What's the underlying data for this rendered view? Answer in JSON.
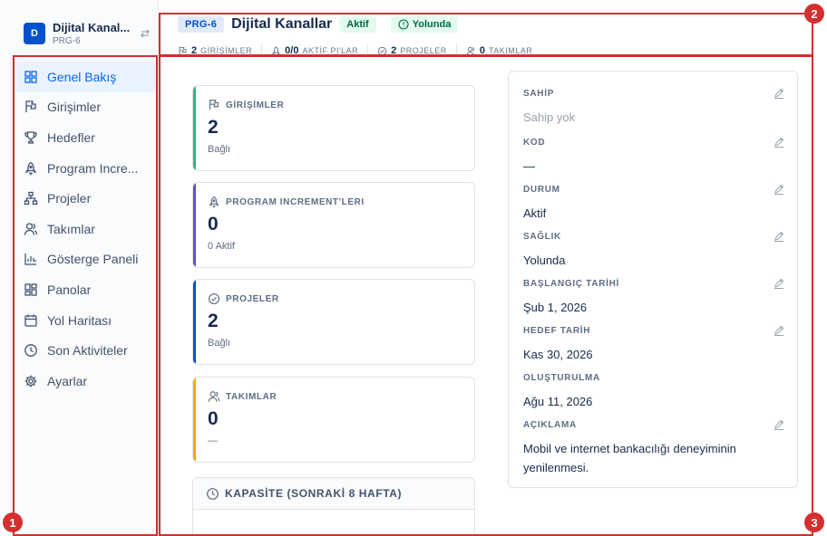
{
  "project": {
    "avatar_letter": "D",
    "name": "Dijital Kanallar",
    "name_truncated": "Dijital Kanal...",
    "key": "PRG-6"
  },
  "sidebar": {
    "items": [
      {
        "label": "Genel Bakış",
        "icon": "grid-icon",
        "active": true
      },
      {
        "label": "Girişimler",
        "icon": "flag-icon"
      },
      {
        "label": "Hedefler",
        "icon": "trophy-icon"
      },
      {
        "label": "Program Incre...",
        "icon": "rocket-icon"
      },
      {
        "label": "Projeler",
        "icon": "hierarchy-icon"
      },
      {
        "label": "Takımlar",
        "icon": "people-icon"
      },
      {
        "label": "Gösterge Paneli",
        "icon": "bar-chart-icon"
      },
      {
        "label": "Panolar",
        "icon": "board-icon"
      },
      {
        "label": "Yol Haritası",
        "icon": "calendar-icon"
      },
      {
        "label": "Son Aktiviteler",
        "icon": "clock-icon"
      },
      {
        "label": "Ayarlar",
        "icon": "gear-icon"
      }
    ]
  },
  "header": {
    "key": "PRG-6",
    "title": "Dijital Kanallar",
    "status": "Aktif",
    "health": "Yolunda",
    "stats": [
      {
        "value": "2",
        "label": "GİRİŞİMLER",
        "icon": "flag-icon"
      },
      {
        "value": "0/0",
        "label": "AKTİF PI'LAR",
        "icon": "rocket-icon"
      },
      {
        "value": "2",
        "label": "PROJELER",
        "icon": "check-circle-icon"
      },
      {
        "value": "0",
        "label": "TAKIMLAR",
        "icon": "people-icon"
      }
    ]
  },
  "cards": [
    {
      "title": "GİRİŞİMLER",
      "value": "2",
      "sub": "Bağlı",
      "icon": "flag-icon",
      "color": "#36b37e"
    },
    {
      "title": "PROGRAM INCREMENT'LERI",
      "value": "0",
      "sub": "0 Aktif",
      "icon": "rocket-icon",
      "color": "#6554c0"
    },
    {
      "title": "PROJELER",
      "value": "2",
      "sub": "Bağlı",
      "icon": "check-circle-icon",
      "color": "#0052cc"
    },
    {
      "title": "TAKIMLAR",
      "value": "0",
      "sub": "—",
      "icon": "people-icon",
      "color": "#ffab00"
    }
  ],
  "capacity": {
    "title": "KAPASİTE (SONRAKİ 8 HAFTA)"
  },
  "details": {
    "fields": [
      {
        "label": "SAHİP",
        "value": "Sahip yok",
        "muted": true,
        "editable": true
      },
      {
        "label": "KOD",
        "value": "—",
        "editable": true
      },
      {
        "label": "DURUM",
        "value": "Aktif",
        "editable": true
      },
      {
        "label": "SAĞLIK",
        "value": "Yolunda",
        "editable": true
      },
      {
        "label": "BAŞLANGIÇ TARİHİ",
        "value": "Şub 1, 2026",
        "editable": true
      },
      {
        "label": "HEDEF TARİH",
        "value": "Kas 30, 2026",
        "editable": true
      },
      {
        "label": "OLUŞTURULMA",
        "value": "Ağu 11, 2026",
        "editable": false
      },
      {
        "label": "AÇIKLAMA",
        "value": "Mobil ve internet bankacılığı deneyiminin yenilenmesi.",
        "editable": true
      }
    ]
  },
  "annotations": [
    {
      "number": "1"
    },
    {
      "number": "2"
    },
    {
      "number": "3"
    }
  ],
  "colors": {
    "accent": "#0052cc",
    "annotation": "#d32f2f"
  }
}
